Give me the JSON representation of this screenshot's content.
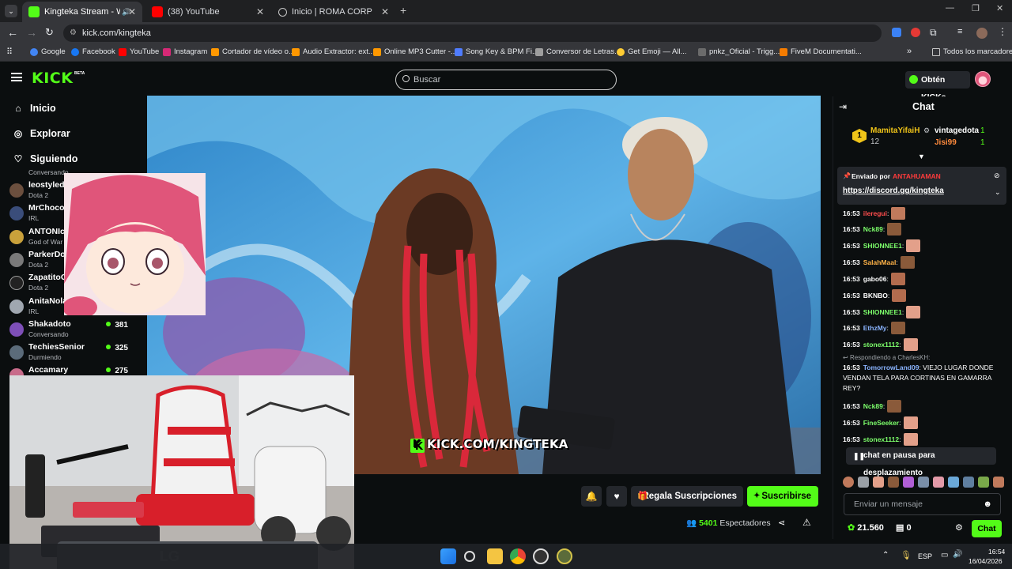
{
  "browser": {
    "tabs": [
      {
        "title": "Kingteka Stream - Watch L",
        "active": true
      },
      {
        "title": "(38) YouTube",
        "active": false
      },
      {
        "title": "Inicio | ROMA CORP",
        "active": false
      }
    ],
    "url": "kick.com/kingteka",
    "bookmarks": [
      "Google",
      "Facebook",
      "YouTube",
      "Instagram",
      "Cortador de vídeo o...",
      "Audio Extractor: ext...",
      "Online MP3 Cutter -...",
      "Song Key & BPM Fi...",
      "Conversor de Letras...",
      "Get Emoji — All...",
      "pnkz_Oficial - Trigg...",
      "FiveM Documentati..."
    ],
    "bookmarks_more": "»",
    "all_bookmarks": "Todos los marcadores"
  },
  "header": {
    "logo": "KICK",
    "logo_badge": "BETA",
    "search_placeholder": "Buscar",
    "kicks_button": "Obtén KICKs"
  },
  "sidebar": {
    "nav": [
      {
        "label": "Inicio",
        "icon": "home-icon"
      },
      {
        "label": "Explorar",
        "icon": "compass-icon"
      },
      {
        "label": "Siguiendo",
        "icon": "heart-icon"
      }
    ],
    "top_partial": "Conversando",
    "channels": [
      {
        "name": "leostyledo",
        "category": "Dota 2",
        "viewers": ""
      },
      {
        "name": "MrChoco",
        "category": "IRL",
        "viewers": ""
      },
      {
        "name": "ANTONIcr",
        "category": "God of War",
        "viewers": ""
      },
      {
        "name": "ParkerDot",
        "category": "Dota 2",
        "viewers": ""
      },
      {
        "name": "ZapatitoG",
        "category": "Dota 2",
        "viewers": ""
      },
      {
        "name": "AnitaNola",
        "category": "IRL",
        "viewers": ""
      },
      {
        "name": "Shakadoto",
        "category": "Conversando",
        "viewers": "381"
      },
      {
        "name": "TechiesSenior",
        "category": "Durmiendo",
        "viewers": "325"
      },
      {
        "name": "Accamary",
        "category": "",
        "viewers": "275"
      }
    ]
  },
  "video": {
    "watermark": "KICK.COM/KINGTEKA"
  },
  "actions": {
    "gift_label": "Regala Suscripciones",
    "subscribe_label": "Suscribirse",
    "viewers_count": "5401",
    "viewers_label": "Espectadores"
  },
  "chat": {
    "title": "Chat",
    "leaderboard": {
      "first": {
        "rank": "1",
        "name": "MamitaYifaiH",
        "value": "12"
      },
      "second": {
        "name": "vintagedota",
        "value": "1"
      },
      "third": {
        "name": "Jisi99",
        "value": "1"
      }
    },
    "pinned_by_label": "Enviado por",
    "pinned_by_user": "ANTAHUAMAN",
    "pinned_link": "https://discord.gg/kingteka",
    "messages": [
      {
        "time": "16:53",
        "user": "ileregui",
        "color": "#ff4d4d"
      },
      {
        "time": "16:53",
        "user": "Nck89",
        "color": "#7dff6b"
      },
      {
        "time": "16:53",
        "user": "SHIONNEE1",
        "color": "#7dff6b"
      },
      {
        "time": "16:53",
        "user": "SalahMaal",
        "color": "#ffb347"
      },
      {
        "time": "16:53",
        "user": "gabo06",
        "color": "#ffffff"
      },
      {
        "time": "16:53",
        "user": "BKNBO",
        "color": "#ffffff"
      },
      {
        "time": "16:53",
        "user": "SHIONNEE1",
        "color": "#7dff6b"
      },
      {
        "time": "16:53",
        "user": "EthzMy",
        "color": "#8ab4ff"
      },
      {
        "time": "16:53",
        "user": "stonex1112",
        "color": "#7dff6b"
      }
    ],
    "reply": {
      "replying_to": "Respondiendo a CharlesKH:",
      "time": "16:53",
      "user": "TomorrowLand09",
      "text": "VIEJO LUGAR DONDE VENDAN TELA PARA CORTINAS EN GAMARRA REY?"
    },
    "messages2": [
      {
        "time": "16:53",
        "user": "Nck89",
        "color": "#7dff6b"
      },
      {
        "time": "16:53",
        "user": "FineSeeker",
        "color": "#7dff6b"
      },
      {
        "time": "16:53",
        "user": "stonex1112",
        "color": "#7dff6b"
      }
    ],
    "paused_label": "chat en pausa para desplazamiento",
    "input_placeholder": "Enviar un mensaje",
    "kicks_balance": "21.560",
    "gifts_count": "0",
    "send_label": "Chat"
  },
  "taskbar": {
    "lang": "ESP",
    "time": "16:54",
    "date": "16/04/2026"
  }
}
